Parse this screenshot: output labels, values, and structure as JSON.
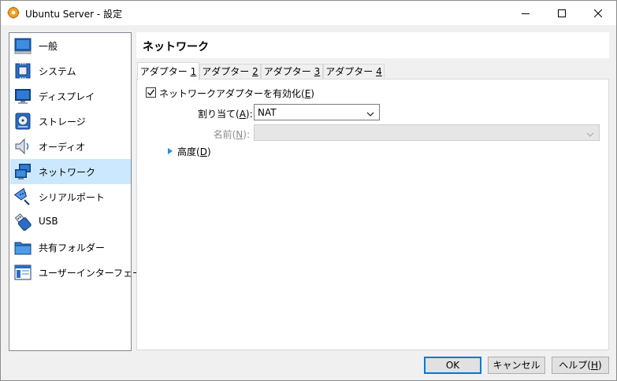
{
  "window": {
    "title": "Ubuntu Server - 設定"
  },
  "sidebar": {
    "items": [
      {
        "label": "一般",
        "icon": "general-icon"
      },
      {
        "label": "システム",
        "icon": "system-icon"
      },
      {
        "label": "ディスプレイ",
        "icon": "display-icon"
      },
      {
        "label": "ストレージ",
        "icon": "storage-icon"
      },
      {
        "label": "オーディオ",
        "icon": "audio-icon"
      },
      {
        "label": "ネットワーク",
        "icon": "network-icon",
        "selected": true
      },
      {
        "label": "シリアルポート",
        "icon": "serial-port-icon"
      },
      {
        "label": "USB",
        "icon": "usb-icon"
      },
      {
        "label": "共有フォルダー",
        "icon": "shared-folder-icon"
      },
      {
        "label": "ユーザーインターフェース",
        "icon": "user-interface-icon"
      }
    ]
  },
  "section": {
    "title": "ネットワーク"
  },
  "tabs": [
    {
      "prefix": "アダプター ",
      "key": "1",
      "selected": true
    },
    {
      "prefix": "アダプター ",
      "key": "2"
    },
    {
      "prefix": "アダプター ",
      "key": "3"
    },
    {
      "prefix": "アダプター ",
      "key": "4"
    }
  ],
  "adapter": {
    "enable_prefix": "ネットワークアダプターを有効化(",
    "enable_key": "E",
    "enable_suffix": ")",
    "enable_checked": true,
    "attached_prefix": "割り当て(",
    "attached_key": "A",
    "attached_suffix": "):",
    "attached_value": "NAT",
    "name_prefix": "名前(",
    "name_key": "N",
    "name_suffix": "):",
    "name_value": "",
    "advanced_prefix": "高度(",
    "advanced_key": "D",
    "advanced_suffix": ")"
  },
  "buttons": {
    "ok": "OK",
    "cancel": "キャンセル",
    "help_prefix": "ヘルプ(",
    "help_key": "H",
    "help_suffix": ")"
  },
  "colors": {
    "selected_bg": "#cce8ff",
    "accent": "#0078d7"
  }
}
